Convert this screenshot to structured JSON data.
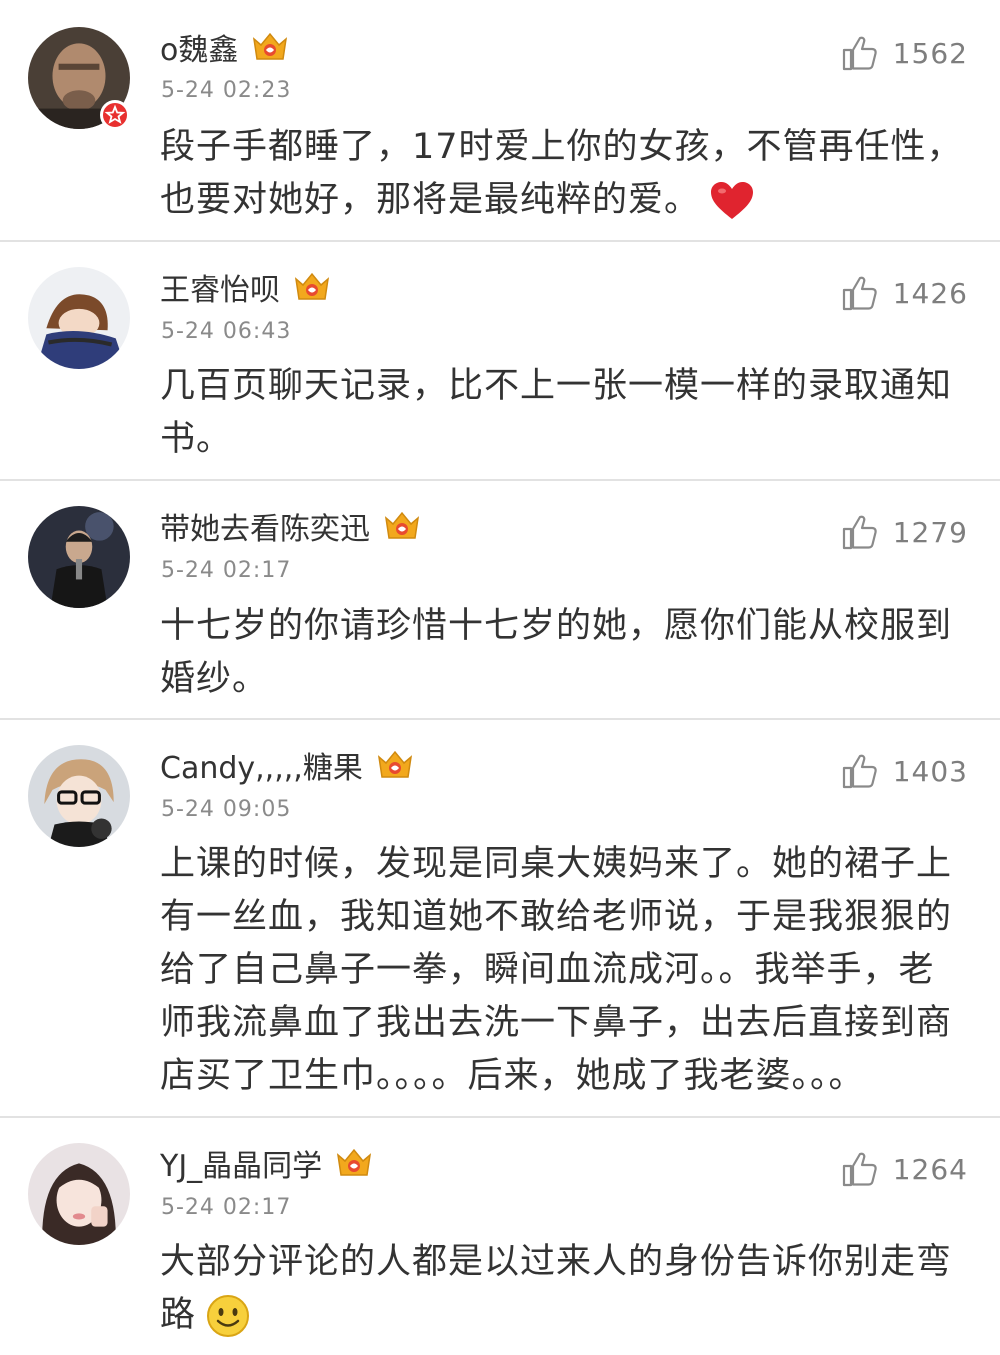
{
  "comments": [
    {
      "name": "o魏鑫",
      "time": "5-24 02:23",
      "likes": "1562",
      "text": "段子手都睡了，17时爱上你的女孩，不管再任性，也要对她好，那将是最纯粹的爱。",
      "emoji": "red-heart",
      "verified": true
    },
    {
      "name": "王睿怡呗",
      "time": "5-24 06:43",
      "likes": "1426",
      "text": "几百页聊天记录，比不上一张一模一样的录取通知书。"
    },
    {
      "name": "带她去看陈奕迅",
      "time": "5-24 02:17",
      "likes": "1279",
      "text": "十七岁的你请珍惜十七岁的她，愿你们能从校服到婚纱。"
    },
    {
      "name": "Candy,,,,,糖果",
      "time": "5-24 09:05",
      "likes": "1403",
      "text": "上课的时候，发现是同桌大姨妈来了。她的裙子上有一丝血，我知道她不敢给老师说，于是我狠狠的给了自己鼻子一拳，瞬间血流成河。。我举手，老师我流鼻血了我出去洗一下鼻子，出去后直接到商店买了卫生巾。。。。后来，她成了我老婆。。。"
    },
    {
      "name": "YJ_晶晶同学",
      "time": "5-24 02:17",
      "likes": "1264",
      "text": "大部分评论的人都是以过来人的身份告诉你别走弯路",
      "emoji": "smiley-face"
    }
  ],
  "colors": {
    "name": "#333333",
    "time": "#8a8a8a",
    "likes": "#7e7e7e",
    "divider": "#e2e2e2",
    "vip_crown": "#f2a81d",
    "verified_badge": "#e8302f"
  },
  "icons": {
    "like": "thumbs-up-icon",
    "member": "vip-crown-icon",
    "verified": "verified-star-icon"
  }
}
